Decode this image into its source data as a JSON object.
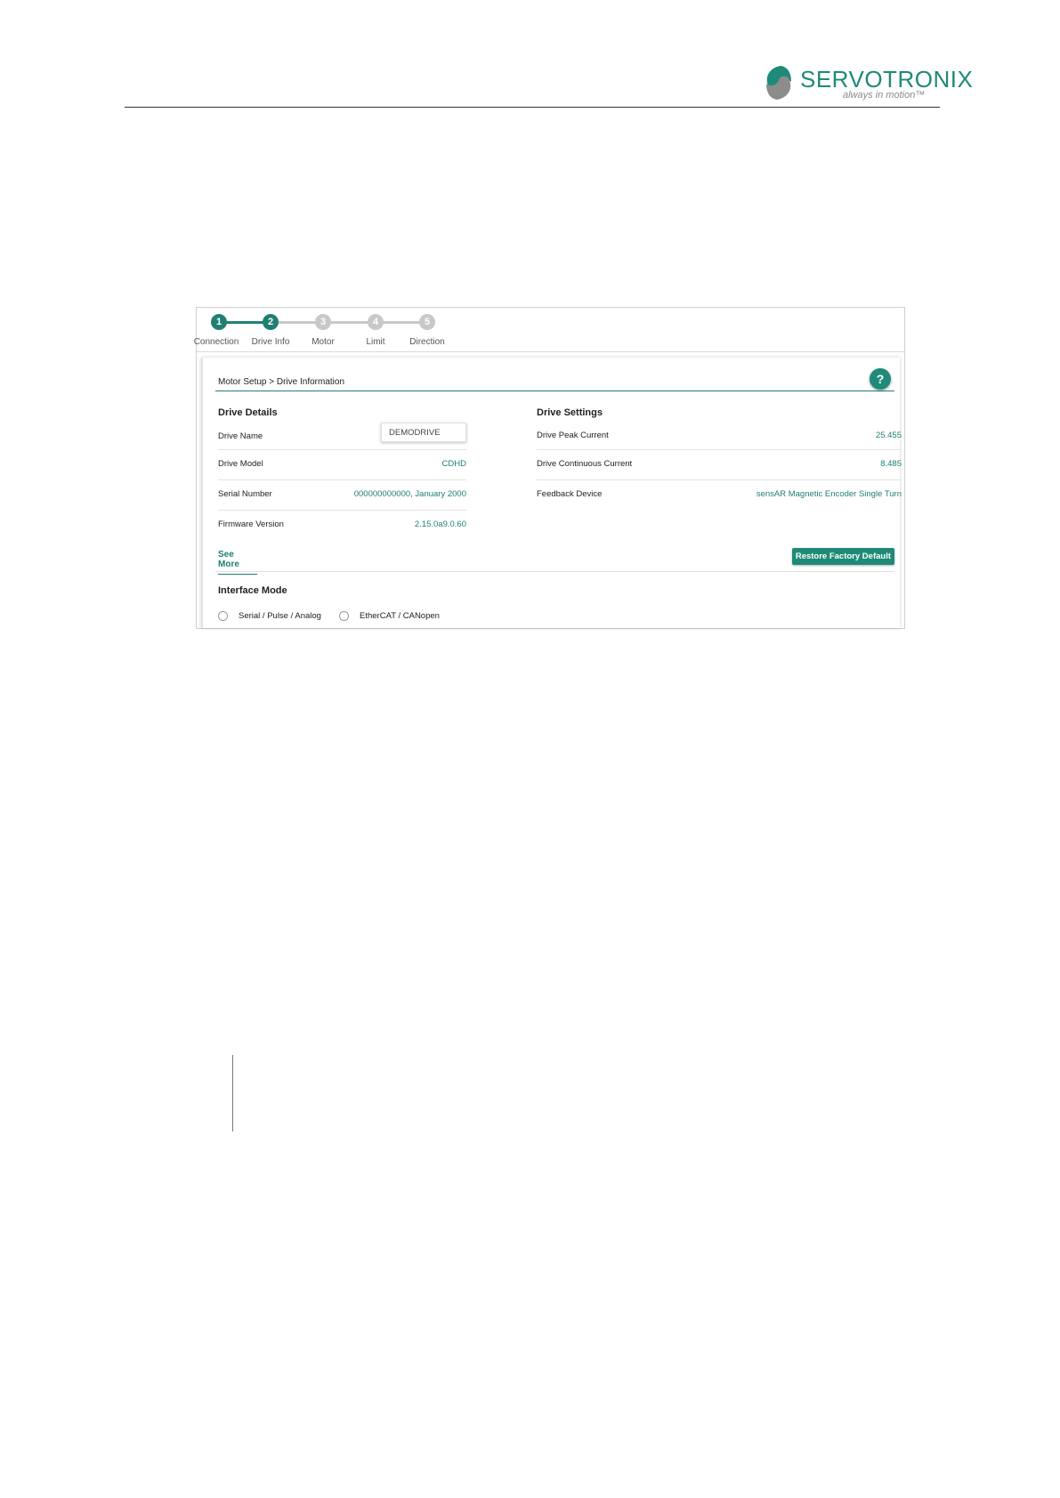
{
  "header": {
    "brand": "SERVOTRONIX",
    "tagline": "always in motion™",
    "brand_color": "#1f8a78"
  },
  "stepper": {
    "active_color": "#1f7f73",
    "inactive_color": "#c8c8c8",
    "steps": [
      {
        "number": "1",
        "label": "Connection",
        "state": "done"
      },
      {
        "number": "2",
        "label": "Drive Info",
        "state": "current"
      },
      {
        "number": "3",
        "label": "Motor",
        "state": "pending"
      },
      {
        "number": "4",
        "label": "Limit",
        "state": "pending"
      },
      {
        "number": "5",
        "label": "Direction",
        "state": "pending"
      }
    ]
  },
  "breadcrumb": "Motor Setup > Drive Information",
  "help_label": "?",
  "drive_details": {
    "title": "Drive Details",
    "name_label": "Drive Name",
    "name_value": "DEMODRIVE",
    "rows": [
      {
        "label": "Drive Model",
        "value": "CDHD"
      },
      {
        "label": "Serial Number",
        "value": "000000000000, January 2000"
      },
      {
        "label": "Firmware Version",
        "value": "2.15.0a9.0.60"
      }
    ],
    "see_more": "See More"
  },
  "drive_settings": {
    "title": "Drive Settings",
    "rows": [
      {
        "label": "Drive Peak Current",
        "value": "25.455"
      },
      {
        "label": "Drive Continuous Current",
        "value": "8.485"
      },
      {
        "label": "Feedback Device",
        "value": "sensAR Magnetic Encoder Single Turn"
      }
    ],
    "restore_button": "Restore Factory Default"
  },
  "interface_mode": {
    "title": "Interface Mode",
    "options": [
      {
        "label": "Serial / Pulse / Analog",
        "selected": false
      },
      {
        "label": "EtherCAT / CANopen",
        "selected": false
      }
    ]
  }
}
